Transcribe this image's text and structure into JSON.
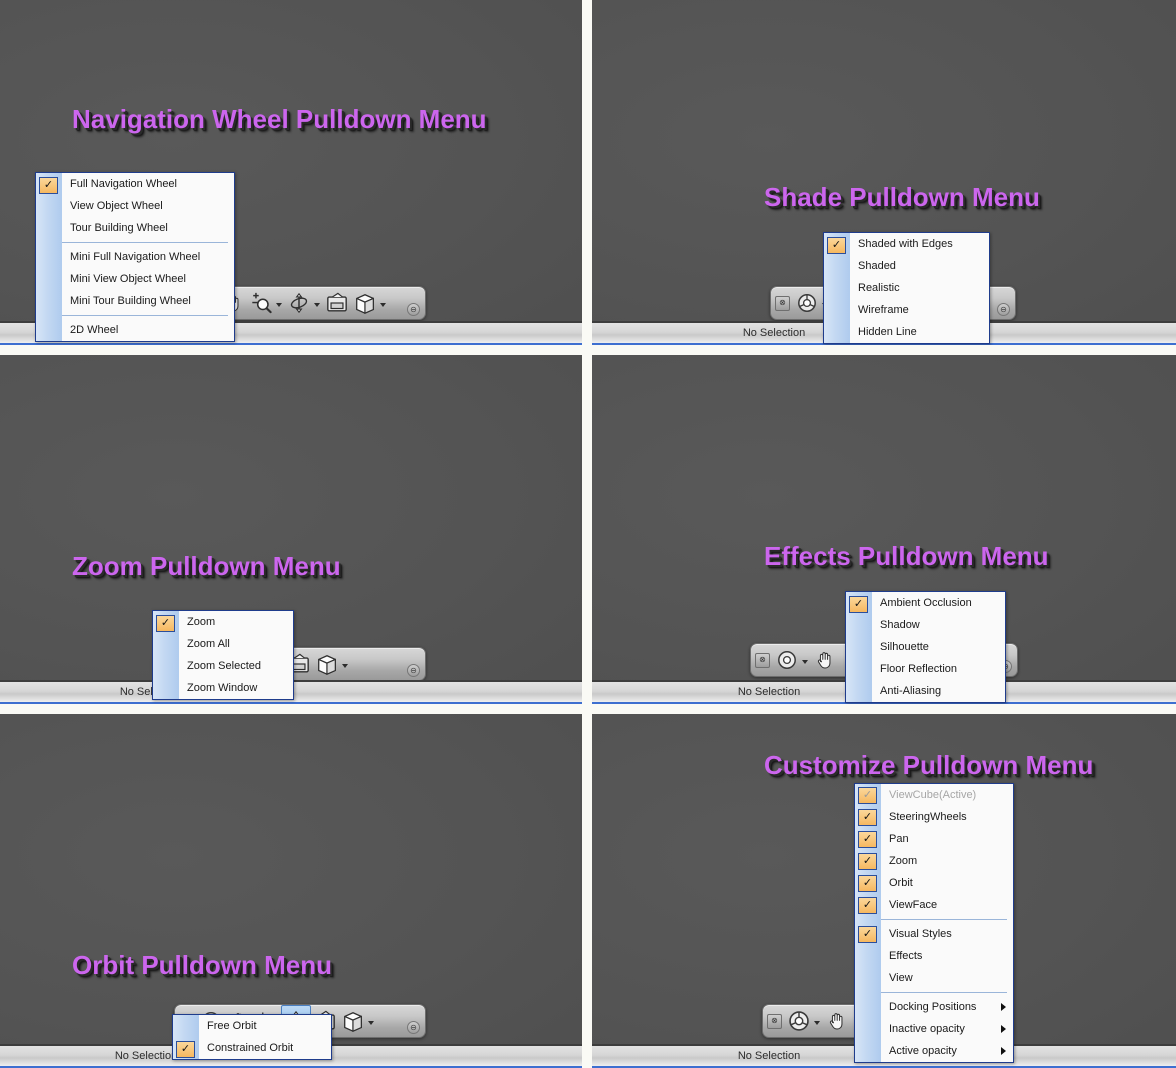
{
  "colors": {
    "title_purple": "#CC66EE",
    "viewport_bg": "#545454",
    "menu_border": "#1F3C8C",
    "check_fill": "#F6B860",
    "gap": "#FAFAF5"
  },
  "panels": [
    {
      "id": "navigation-wheel",
      "title": "Navigation Wheel Pulldown Menu",
      "status_text": "",
      "menu": {
        "items": [
          {
            "label": "Full Navigation Wheel",
            "checked": true
          },
          {
            "label": "View Object Wheel",
            "checked": false
          },
          {
            "label": "Tour Building Wheel",
            "checked": false
          },
          {
            "separator": true
          },
          {
            "label": "Mini Full Navigation Wheel",
            "checked": false
          },
          {
            "label": "Mini View Object Wheel",
            "checked": false
          },
          {
            "label": "Mini Tour Building Wheel",
            "checked": false
          },
          {
            "separator": true
          },
          {
            "label": "2D Wheel",
            "checked": false
          }
        ]
      }
    },
    {
      "id": "shade",
      "title": "Shade Pulldown Menu",
      "status_text": "No Selection",
      "menu": {
        "items": [
          {
            "label": "Shaded with Edges",
            "checked": true
          },
          {
            "label": "Shaded",
            "checked": false
          },
          {
            "label": "Realistic",
            "checked": false
          },
          {
            "label": "Wireframe",
            "checked": false
          },
          {
            "label": "Hidden Line",
            "checked": false
          }
        ]
      }
    },
    {
      "id": "zoom",
      "title": "Zoom Pulldown Menu",
      "status_text": "No Selection",
      "menu": {
        "items": [
          {
            "label": "Zoom",
            "checked": true
          },
          {
            "label": "Zoom All",
            "checked": false
          },
          {
            "label": "Zoom Selected",
            "checked": false
          },
          {
            "label": "Zoom Window",
            "checked": false
          }
        ]
      }
    },
    {
      "id": "effects",
      "title": "Effects Pulldown Menu",
      "status_text": "No Selection",
      "menu": {
        "items": [
          {
            "label": "Ambient Occlusion",
            "checked": true
          },
          {
            "label": "Shadow",
            "checked": false
          },
          {
            "label": "Silhouette",
            "checked": false
          },
          {
            "label": "Floor Reflection",
            "checked": false
          },
          {
            "label": "Anti-Aliasing",
            "checked": false
          }
        ]
      }
    },
    {
      "id": "orbit",
      "title": "Orbit Pulldown Menu",
      "status_text": "No Selection",
      "menu": {
        "items": [
          {
            "label": "Free Orbit",
            "checked": false
          },
          {
            "label": "Constrained Orbit",
            "checked": true
          }
        ]
      }
    },
    {
      "id": "customize",
      "title": "Customize Pulldown Menu",
      "status_text": "No Selection",
      "menu": {
        "items": [
          {
            "label": "ViewCube(Active)",
            "checked": true,
            "disabled": true
          },
          {
            "label": "SteeringWheels",
            "checked": true
          },
          {
            "label": "Pan",
            "checked": true
          },
          {
            "label": "Zoom",
            "checked": true
          },
          {
            "label": "Orbit",
            "checked": true
          },
          {
            "label": "ViewFace",
            "checked": true
          },
          {
            "separator": true
          },
          {
            "label": "Visual Styles",
            "checked": true
          },
          {
            "label": "Effects",
            "checked": false
          },
          {
            "label": "View",
            "checked": false
          },
          {
            "separator": true
          },
          {
            "label": "Docking Positions",
            "checked": false,
            "submenu": true
          },
          {
            "label": "Inactive opacity",
            "checked": false,
            "submenu": true
          },
          {
            "label": "Active opacity",
            "checked": false,
            "submenu": true
          }
        ]
      }
    }
  ],
  "navbar": {
    "close_glyph": "⊗",
    "grip_glyph": "⊖",
    "tools": [
      {
        "name": "steering-wheel-tool",
        "dropdown": true
      },
      {
        "name": "pan-hand-tool",
        "dropdown": false
      },
      {
        "name": "zoom-tool",
        "dropdown": true
      },
      {
        "name": "orbit-tool",
        "dropdown": true
      },
      {
        "name": "look-camera-tool",
        "dropdown": false
      },
      {
        "name": "view-cube-tool",
        "dropdown": true
      }
    ]
  }
}
